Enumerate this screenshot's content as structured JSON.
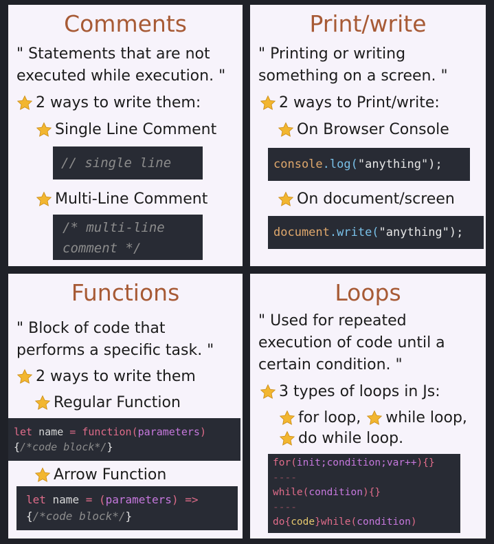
{
  "comments": {
    "title": "Comments",
    "desc_line1": "\" Statements that are not",
    "desc_line2": "executed while execution. \"",
    "ways": "2 ways to write them:",
    "single_label": "Single Line Comment",
    "single_code": "// single line",
    "multi_label": "Multi-Line Comment",
    "multi_code_line1": "/* multi-line",
    "multi_code_line2": "comment */"
  },
  "print": {
    "title": "Print/write",
    "desc_line1": "\" Printing or writing",
    "desc_line2": "something on a screen. \"",
    "ways": "2 ways to Print/write:",
    "console_label": "On Browser Console",
    "console_obj": "console",
    "console_method": ".log(",
    "console_arg": "\"anything\"",
    "console_end": ");",
    "doc_label": "On document/screen",
    "doc_obj": "document",
    "doc_method": ".write(",
    "doc_arg": "\"anything\"",
    "doc_end": ");"
  },
  "functions": {
    "title": "Functions",
    "desc_line1": "\" Block of code that",
    "desc_line2": "performs a specific task. \"",
    "ways": "2 ways to write them",
    "regular_label": "Regular Function",
    "reg_let": "let",
    "reg_name": " name ",
    "reg_eq": "=",
    "reg_fn": " function(",
    "reg_param": "parameters",
    "reg_close": ")",
    "reg_block_open": "{",
    "reg_block_cmt": "/*code block*/",
    "reg_block_close": "}",
    "arrow_label": "Arrow Function",
    "arr_let": "let",
    "arr_name": " name ",
    "arr_eq": "=",
    "arr_open": " (",
    "arr_param": "parameters",
    "arr_close": ")",
    "arr_arrow": " =>",
    "arr_block_open": "{",
    "arr_block_cmt": "/*code block*/",
    "arr_block_close": "}"
  },
  "loops": {
    "title": "Loops",
    "desc_line1": "\" Used for repeated",
    "desc_line2": "execution of code until a",
    "desc_line3": "certain condition. \"",
    "types": "3 types of loops in Js:",
    "for_label": "for loop,",
    "while_label": "while loop,",
    "dowhile_label": "do while loop.",
    "code_for_kw": "for(",
    "code_for_body": "init;condition;var++",
    "code_for_end": "){}",
    "code_sep1": "----",
    "code_while_kw": "while(",
    "code_while_body": "condition",
    "code_while_end": "){}",
    "code_sep2": "----",
    "code_do_kw": "do{",
    "code_do_body": "code",
    "code_do_mid": "}while(",
    "code_do_cond": "condition",
    "code_do_end": ")"
  },
  "colors": {
    "panel_bg": "#f7f3fb",
    "title": "#a75a35",
    "code_bg": "#282b34",
    "star": "#f2b630"
  }
}
